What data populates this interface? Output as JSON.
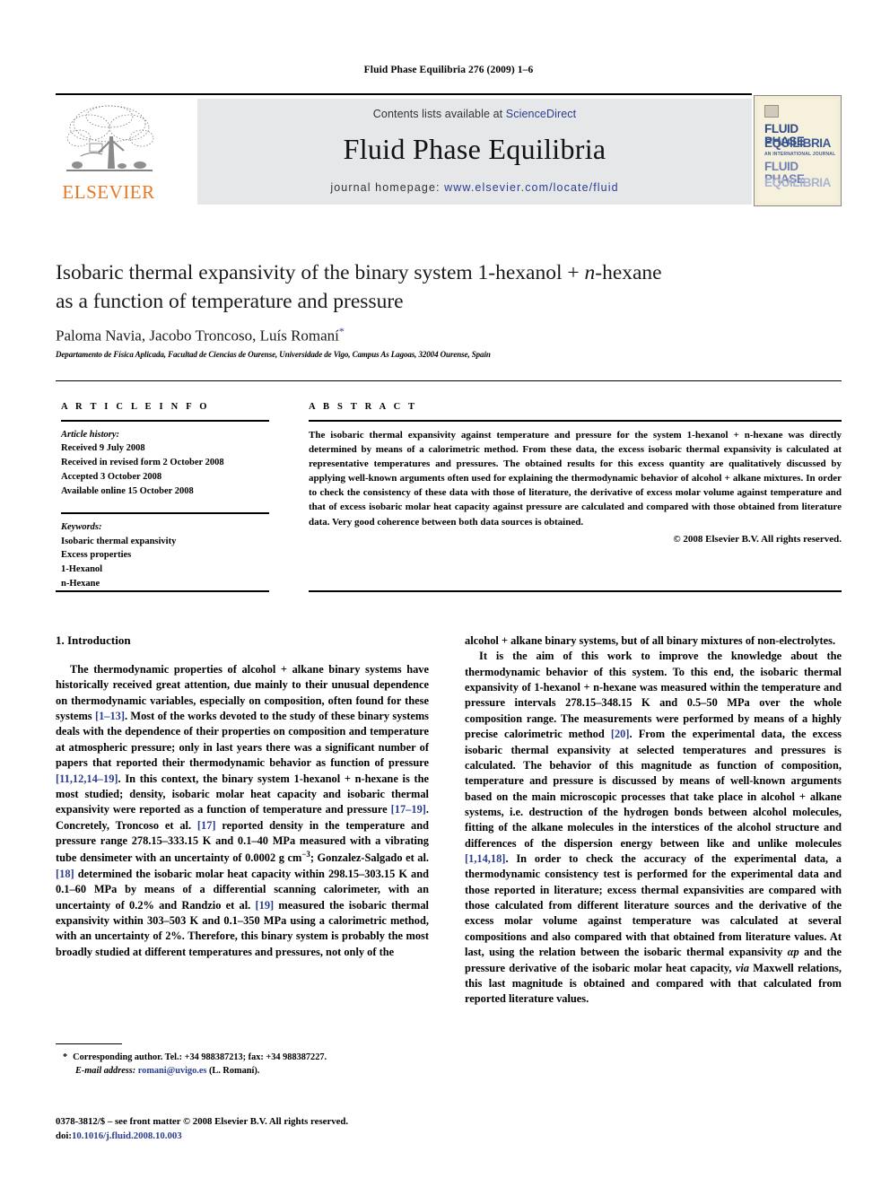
{
  "running_head": "Fluid Phase Equilibria 276 (2009) 1–6",
  "masthead": {
    "publisher_logo_text": "ELSEVIER",
    "contents_prefix": "Contents lists available at ",
    "contents_link": "ScienceDirect",
    "journal_name": "Fluid Phase Equilibria",
    "homepage_prefix": "journal homepage: ",
    "homepage_link": "www.elsevier.com/locate/fluid",
    "cover": {
      "line1": "FLUID PHASE",
      "line2": "EQUILIBRIA",
      "subtitle": "AN INTERNATIONAL JOURNAL",
      "line3": "FLUID PHASE",
      "line4": "EQUILIBRIA"
    },
    "link_color": "#2b3d8f",
    "band_color": "#e6e7e9",
    "elsevier_orange": "#E87722"
  },
  "article": {
    "title_line1_a": "Isobaric thermal expansivity of the binary system 1-hexanol + ",
    "title_line1_b": "n",
    "title_line1_c": "-hexane",
    "title_line2": "as a function of temperature and pressure",
    "authors": "Paloma Navia, Jacobo Troncoso, Luís Romaní",
    "corresponding_marker": "*",
    "affiliation": "Departamento de Física Aplicada, Facultad de Ciencias de Ourense, Universidade de Vigo, Campus As Lagoas, 32004 Ourense, Spain"
  },
  "article_info": {
    "heading": "A R T I C L E   I N F O",
    "history_label": "Article history:",
    "history": [
      "Received 9 July 2008",
      "Received in revised form 2 October 2008",
      "Accepted 3 October 2008",
      "Available online 15 October 2008"
    ],
    "keywords_label": "Keywords:",
    "keywords": [
      "Isobaric thermal expansivity",
      "Excess properties",
      "1-Hexanol",
      "n-Hexane"
    ]
  },
  "abstract": {
    "heading": "A B S T R A C T",
    "text": "The isobaric thermal expansivity against temperature and pressure for the system 1-hexanol + n-hexane was directly determined by means of a calorimetric method. From these data, the excess isobaric thermal expansivity is calculated at representative temperatures and pressures. The obtained results for this excess quantity are qualitatively discussed by applying well-known arguments often used for explaining the thermodynamic behavior of alcohol + alkane mixtures. In order to check the consistency of these data with those of literature, the derivative of excess molar volume against temperature and that of excess isobaric molar heat capacity against pressure are calculated and compared with those obtained from literature data. Very good coherence between both data sources is obtained.",
    "copyright": "© 2008 Elsevier B.V. All rights reserved."
  },
  "body": {
    "section_heading": "1.  Introduction",
    "left_para1_pre": "The thermodynamic properties of alcohol + alkane binary systems have historically received great attention, due mainly to their unusual dependence on thermodynamic variables, especially on composition, often found for these systems ",
    "left_ref1": "[1–13]",
    "left_para1_mid": ". Most of the works devoted to the study of these binary systems deals with the dependence of their properties on composition and temperature at atmospheric pressure; only in last years there was a significant number of papers that reported their thermodynamic behavior as function of pressure ",
    "left_ref2": "[11,12,14–19]",
    "left_para1_mid2": ". In this context, the binary system 1-hexanol + n-hexane is the most studied; density, isobaric molar heat capacity and isobaric thermal expansivity were reported as a function of temperature and pressure ",
    "left_ref3": "[17–19]",
    "left_para1_mid3": ". Concretely, Troncoso et al. ",
    "left_ref4": "[17]",
    "left_para1_mid4": " reported density in the temperature and pressure range 278.15–333.15 K and 0.1–40 MPa measured with a vibrating tube densimeter with an uncertainty of 0.0002 g cm",
    "left_sup1": "−3",
    "left_para1_mid5": "; Gonzalez-Salgado et al. ",
    "left_ref5": "[18]",
    "left_para1_mid6": " determined the isobaric molar heat capacity within 298.15–303.15 K and 0.1–60 MPa by means of a differential scanning calorimeter, with an uncertainty of 0.2% and Randzio et al. ",
    "left_ref6": "[19]",
    "left_para1_end": " measured the isobaric thermal expansivity within 303–503 K and 0.1–350 MPa using a calorimetric method, with an uncertainty of 2%. Therefore, this binary system is probably the most broadly studied at different temperatures and pressures, not only of the",
    "right_para_cont": "alcohol + alkane binary systems, but of all binary mixtures of non-electrolytes.",
    "right_para2_pre": "It is the aim of this work to improve the knowledge about the thermodynamic behavior of this system. To this end, the isobaric thermal expansivity of 1-hexanol + n-hexane was measured within the temperature and pressure intervals 278.15–348.15 K and 0.5–50 MPa over the whole composition range. The measurements were performed by means of a highly precise calorimetric method ",
    "right_ref1": "[20]",
    "right_para2_mid": ". From the experimental data, the excess isobaric thermal expansivity at selected temperatures and pressures is calculated. The behavior of this magnitude as function of composition, temperature and pressure is discussed by means of well-known arguments based on the main microscopic processes that take place in alcohol + alkane systems, i.e. destruction of the hydrogen bonds between alcohol molecules, fitting of the alkane molecules in the interstices of the alcohol structure and differences of the dispersion energy between like and unlike molecules ",
    "right_ref2": "[1,14,18]",
    "right_para2_mid2": ". In order to check the accuracy of the experimental data, a thermodynamic consistency test is performed for the experimental data and those reported in literature; excess thermal expansivities are compared with those calculated from different literature sources and the derivative of the excess molar volume against temperature was calculated at several compositions and also compared with that obtained from literature values. At last, using the relation between the isobaric thermal expansivity ",
    "right_alpha": "αp",
    "right_para2_mid3": " and the pressure derivative of the isobaric molar heat capacity, ",
    "right_via": "via",
    "right_para2_end": " Maxwell relations, this last magnitude is obtained and compared with that calculated from reported literature values."
  },
  "footnote": {
    "marker": "*",
    "corresponding": "Corresponding author. Tel.: +34 988387213; fax: +34 988387227.",
    "email_label": "E-mail address:",
    "email": "romani@uvigo.es",
    "email_owner": "(L. Romaní)."
  },
  "imprint": {
    "line1": "0378-3812/$ – see front matter © 2008 Elsevier B.V. All rights reserved.",
    "doi_label": "doi:",
    "doi_value": "10.1016/j.fluid.2008.10.003"
  }
}
